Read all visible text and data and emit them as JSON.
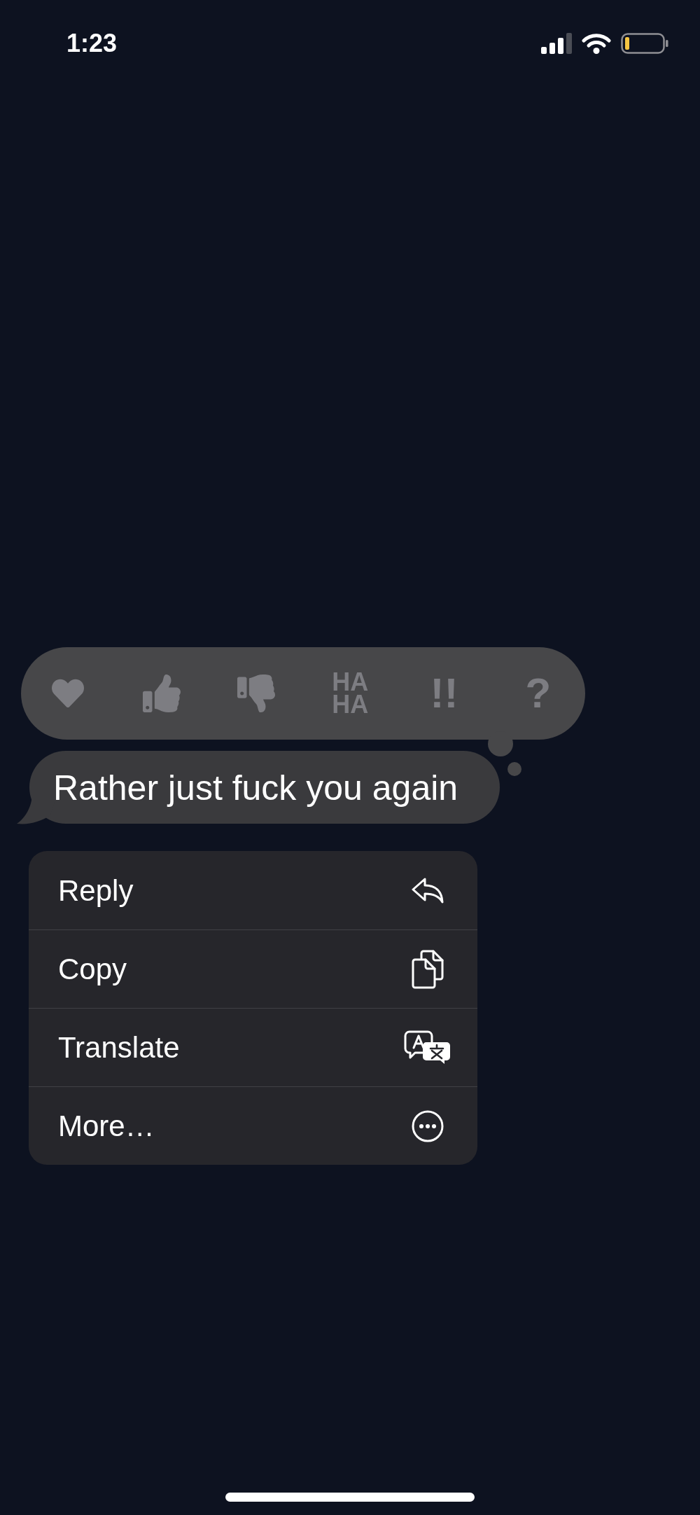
{
  "status_bar": {
    "time": "1:23"
  },
  "reactions": [
    {
      "kind": "heart"
    },
    {
      "kind": "thumbs_up"
    },
    {
      "kind": "thumbs_down"
    },
    {
      "kind": "text",
      "label": "HA HA"
    },
    {
      "kind": "text",
      "label": "!!"
    },
    {
      "kind": "text",
      "label": "?"
    }
  ],
  "message": {
    "text": "Rather just fuck you again"
  },
  "menu": [
    {
      "kind": "reply",
      "label": "Reply"
    },
    {
      "kind": "copy",
      "label": "Copy"
    },
    {
      "kind": "translate",
      "label": "Translate"
    },
    {
      "kind": "more",
      "label": "More…"
    }
  ]
}
